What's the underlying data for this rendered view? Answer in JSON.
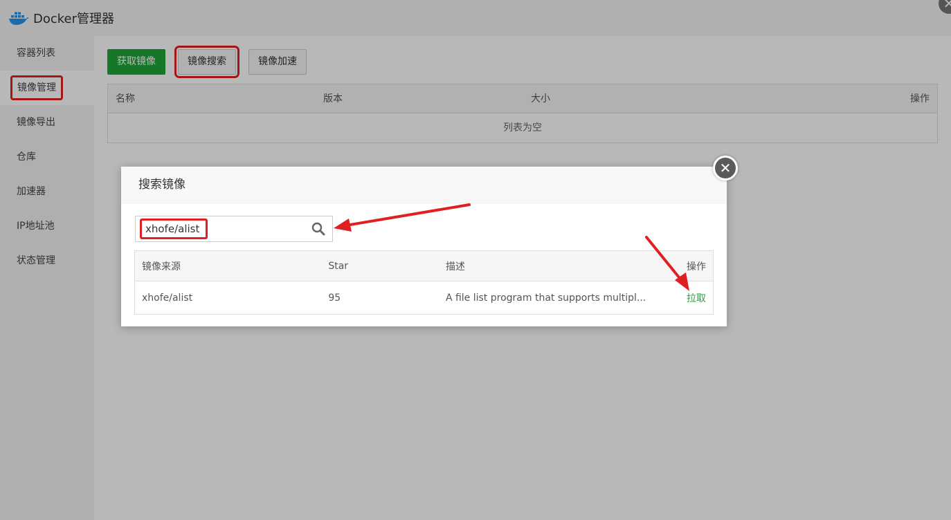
{
  "app": {
    "title": "Docker管理器",
    "close_glyph": "✕"
  },
  "sidebar": {
    "items": [
      {
        "label": "容器列表"
      },
      {
        "label": "镜像管理"
      },
      {
        "label": "镜像导出"
      },
      {
        "label": "仓库"
      },
      {
        "label": "加速器"
      },
      {
        "label": "IP地址池"
      },
      {
        "label": "状态管理"
      }
    ],
    "active_index": 1
  },
  "toolbar": {
    "pull_label": "获取镜像",
    "search_label": "镜像搜索",
    "accelerate_label": "镜像加速"
  },
  "image_table": {
    "headers": [
      "名称",
      "版本",
      "大小",
      "操作"
    ],
    "empty_text": "列表为空"
  },
  "modal": {
    "title": "搜索镜像",
    "close_glyph": "✕",
    "search": {
      "value": "xhofe/alist"
    },
    "headers": [
      "镜像来源",
      "Star",
      "描述",
      "操作"
    ],
    "rows": [
      {
        "source": "xhofe/alist",
        "star": "95",
        "description": "A file list program that supports multipl...",
        "action": "拉取"
      }
    ]
  },
  "colors": {
    "accent_green": "#20a53a",
    "highlight_red": "#e02020"
  },
  "icons": {
    "logo": "docker-whale-icon",
    "search": "magnifier-icon"
  }
}
